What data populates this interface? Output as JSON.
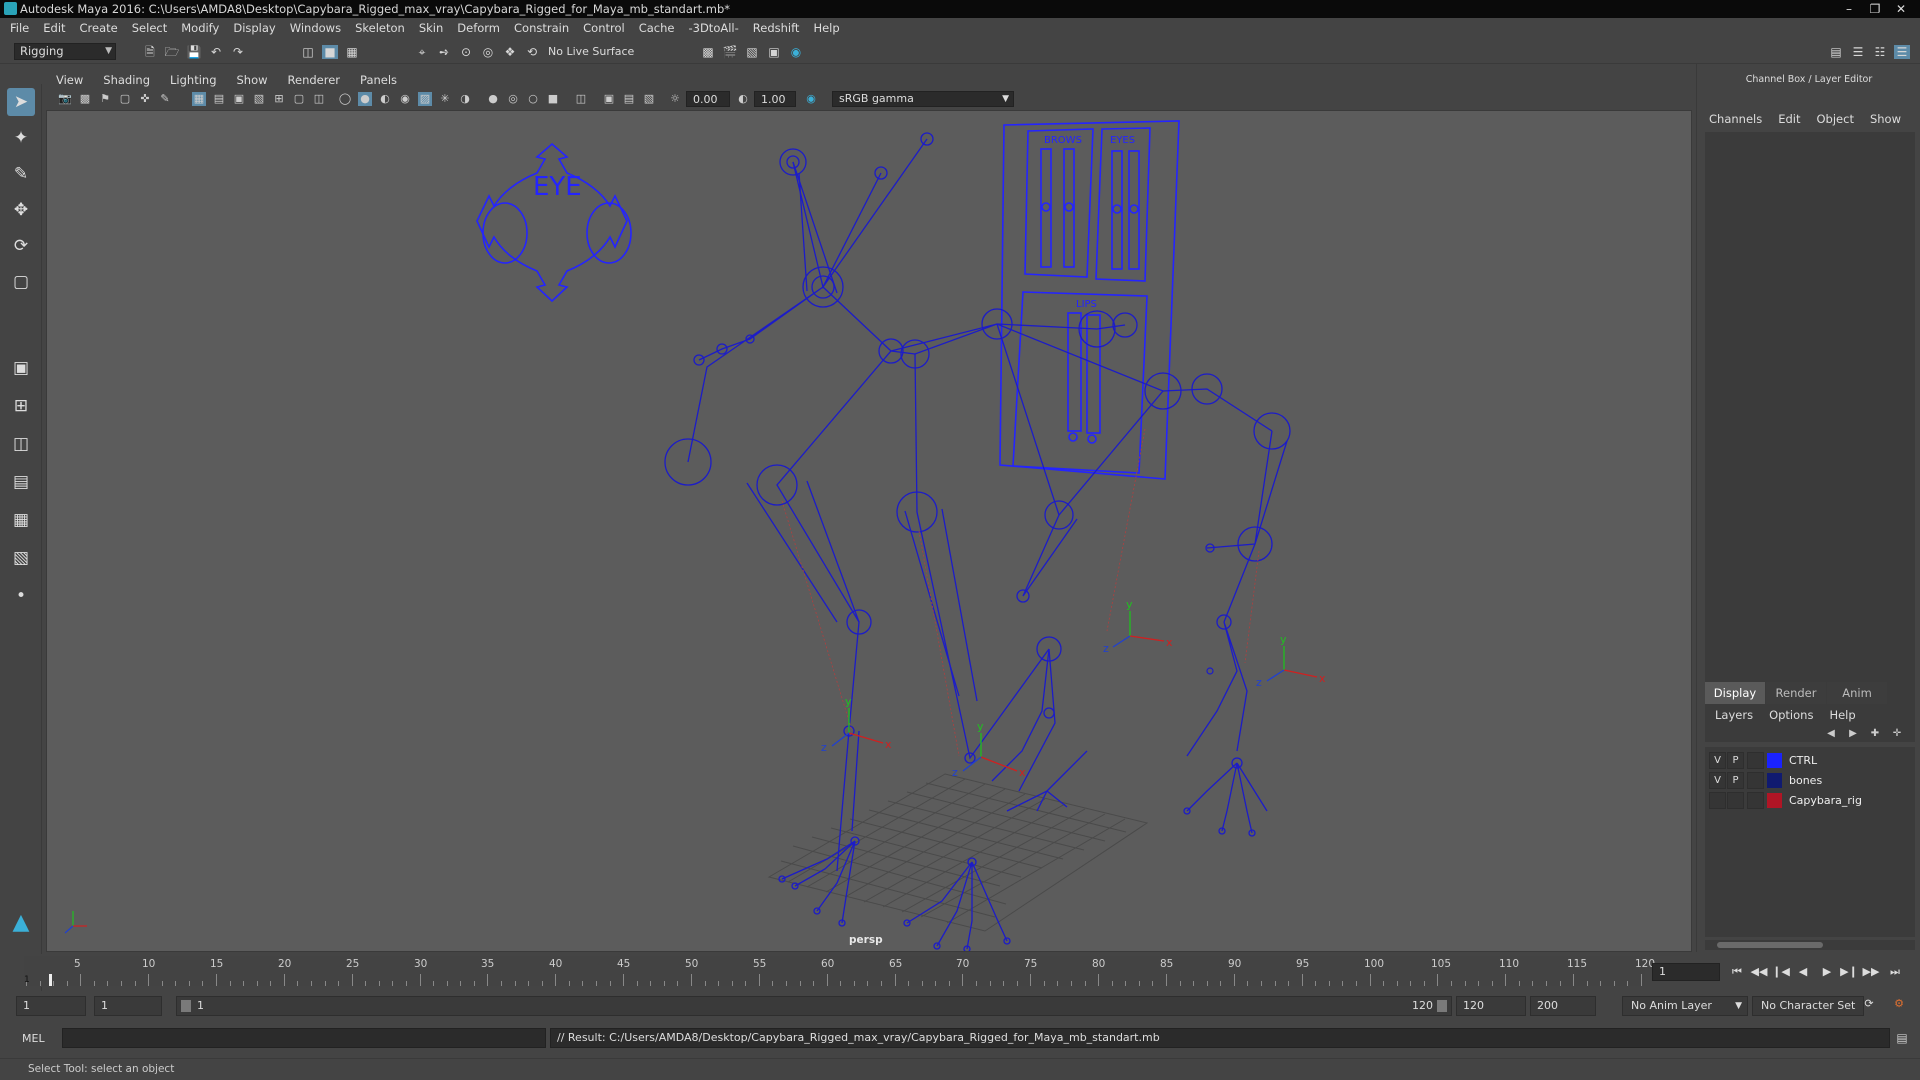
{
  "window": {
    "title": "Autodesk Maya 2016: C:\\Users\\AMDA8\\Desktop\\Capybara_Rigged_max_vray\\Capybara_Rigged_for_Maya_mb_standart.mb*"
  },
  "menubar": [
    "File",
    "Edit",
    "Create",
    "Select",
    "Modify",
    "Display",
    "Windows",
    "Skeleton",
    "Skin",
    "Deform",
    "Constrain",
    "Control",
    "Cache",
    "-3DtoAll-",
    "Redshift",
    "Help"
  ],
  "statusline": {
    "menu_set": "Rigging",
    "live_surface": "No Live Surface"
  },
  "panel": {
    "menus": [
      "View",
      "Shading",
      "Lighting",
      "Show",
      "Renderer",
      "Panels"
    ],
    "near_value": "0.00",
    "far_value": "1.00",
    "color_space": "sRGB gamma",
    "camera_label": "persp"
  },
  "viewport_labels": {
    "eye": "EYE",
    "brows": "BROWS",
    "eyes": "EYES",
    "lips": "LIPS",
    "axis_x": "x",
    "axis_y": "y",
    "axis_z": "z"
  },
  "channel_box": {
    "title": "Channel Box / Layer Editor",
    "menus": [
      "Channels",
      "Edit",
      "Object",
      "Show"
    ]
  },
  "layer_editor": {
    "tabs": [
      "Display",
      "Render",
      "Anim"
    ],
    "active_tab": "Display",
    "menus": [
      "Layers",
      "Options",
      "Help"
    ],
    "layers": [
      {
        "v": "V",
        "p": "P",
        "name": "CTRL",
        "color": "#1a22ff"
      },
      {
        "v": "V",
        "p": "P",
        "name": "bones",
        "color": "#101a70"
      },
      {
        "v": "",
        "p": "",
        "name": "Capybara_rig",
        "color": "#b01525"
      }
    ]
  },
  "time_slider": {
    "start": 1,
    "end": 120,
    "major_ticks": [
      5,
      10,
      15,
      20,
      25,
      30,
      35,
      40,
      45,
      50,
      55,
      60,
      65,
      70,
      75,
      80,
      85,
      90,
      95,
      100,
      105,
      110,
      115,
      120
    ],
    "current_frame": "1",
    "current_frame_field": "1"
  },
  "range_slider": {
    "anim_start": "1",
    "playback_start": "1",
    "range_left": "1",
    "range_right": "120",
    "playback_end": "120",
    "anim_end": "200",
    "anim_layer": "No Anim Layer",
    "character_set": "No Character Set"
  },
  "command_line": {
    "lang": "MEL",
    "result": "// Result: C:/Users/AMDA8/Desktop/Capybara_Rigged_max_vray/Capybara_Rigged_for_Maya_mb_standart.mb"
  },
  "help_line": "Select Tool: select an object",
  "colors": {
    "wire_blue": "#1c1cc8",
    "ctrl_blue": "#2424ff",
    "viewport_bg": "#5c5c5c",
    "axis_x": "#d02020",
    "axis_y": "#20c020",
    "axis_z": "#2040d0",
    "active_tool": "#5d8ba8"
  }
}
